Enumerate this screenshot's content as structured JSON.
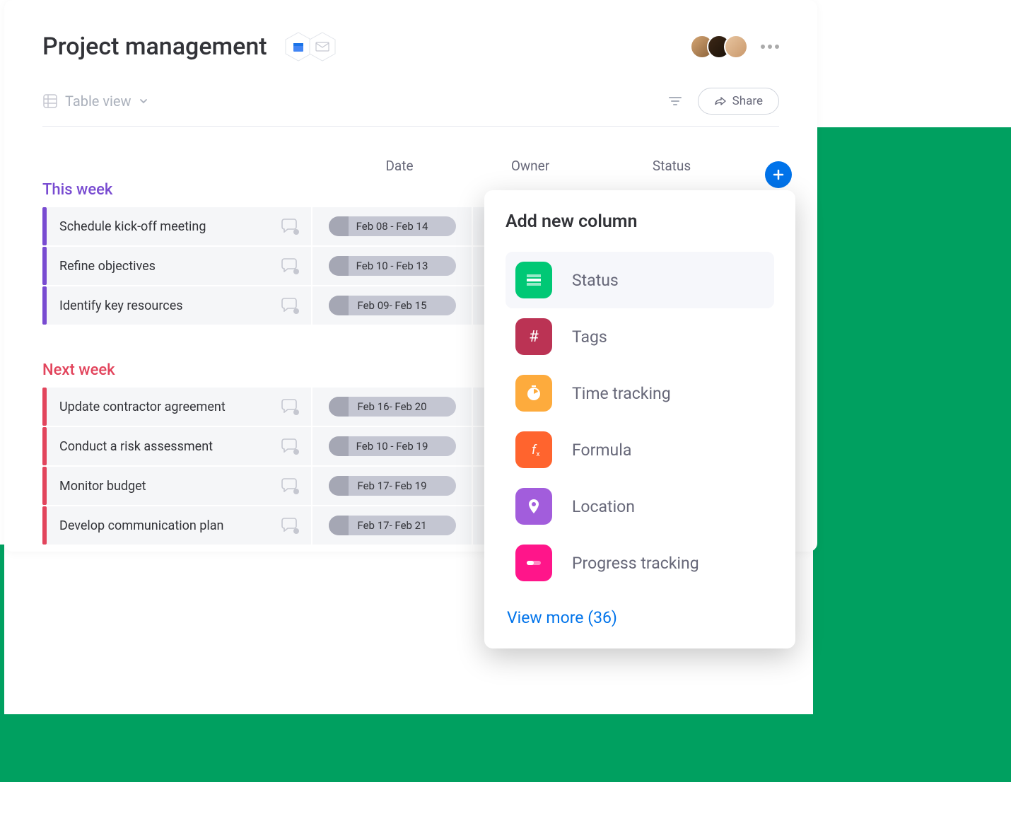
{
  "page": {
    "title": "Project management"
  },
  "toolbar": {
    "view_label": "Table view",
    "share_label": "Share"
  },
  "columns": {
    "date": "Date",
    "owner": "Owner",
    "status": "Status"
  },
  "groups": [
    {
      "id": "this-week",
      "title": "This week",
      "color": "purple",
      "tasks": [
        {
          "name": "Schedule kick-off meeting",
          "date": "Feb 08 - Feb 14"
        },
        {
          "name": "Refine objectives",
          "date": "Feb 10 - Feb 13"
        },
        {
          "name": "Identify key resources",
          "date": "Feb 09- Feb 15"
        }
      ]
    },
    {
      "id": "next-week",
      "title": "Next week",
      "color": "red",
      "tasks": [
        {
          "name": "Update contractor agreement",
          "date": "Feb 16- Feb 20"
        },
        {
          "name": "Conduct a risk assessment",
          "date": "Feb 10 - Feb 19"
        },
        {
          "name": "Monitor budget",
          "date": "Feb 17- Feb 19"
        },
        {
          "name": "Develop communication plan",
          "date": "Feb 17- Feb 21"
        }
      ]
    }
  ],
  "popup": {
    "title": "Add new column",
    "options": [
      {
        "label": "Status",
        "icon": "status",
        "color": "#00c875",
        "active": true
      },
      {
        "label": "Tags",
        "icon": "hash",
        "color": "#bb3354",
        "active": false
      },
      {
        "label": "Time tracking",
        "icon": "timer",
        "color": "#fdab3d",
        "active": false
      },
      {
        "label": "Formula",
        "icon": "fx",
        "color": "#ff642e",
        "active": false
      },
      {
        "label": "Location",
        "icon": "pin",
        "color": "#a25ddc",
        "active": false
      },
      {
        "label": "Progress tracking",
        "icon": "progress",
        "color": "#ff158a",
        "active": false
      }
    ],
    "view_more": "View more (36)"
  }
}
